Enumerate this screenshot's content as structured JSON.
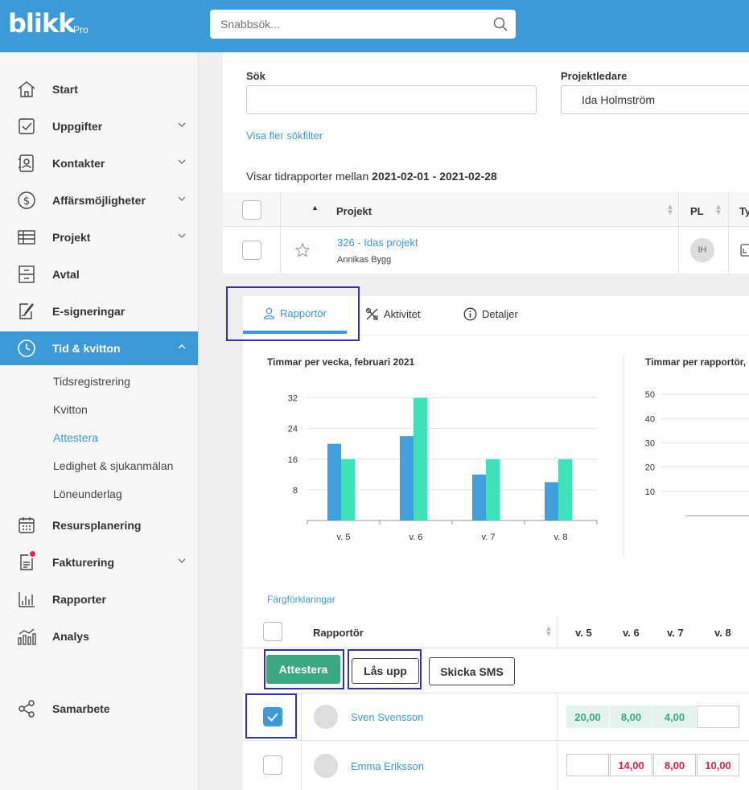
{
  "app": {
    "logo": "blikk",
    "logo_suffix": "Pro"
  },
  "search": {
    "placeholder": "Snabbsök..."
  },
  "sidebar": {
    "items": [
      {
        "label": "Start",
        "icon": "home-icon"
      },
      {
        "label": "Uppgifter",
        "icon": "checkbox-icon"
      },
      {
        "label": "Kontakter",
        "icon": "contacts-icon"
      },
      {
        "label": "Affärsmöjligheter",
        "icon": "dollar-icon"
      },
      {
        "label": "Projekt",
        "icon": "table-icon"
      },
      {
        "label": "Avtal",
        "icon": "cabinet-icon"
      },
      {
        "label": "E-signeringar",
        "icon": "signature-icon"
      },
      {
        "label": "Tid & kvitton",
        "icon": "clock-icon"
      },
      {
        "label": "Resursplanering",
        "icon": "calendar-icon"
      },
      {
        "label": "Fakturering",
        "icon": "invoice-icon"
      },
      {
        "label": "Rapporter",
        "icon": "bar-chart-icon"
      },
      {
        "label": "Analys",
        "icon": "analytics-icon"
      },
      {
        "label": "Samarbete",
        "icon": "share-icon"
      }
    ],
    "sub_items": [
      "Tidsregistrering",
      "Kvitton",
      "Attestera",
      "Ledighet & sjukanmälan",
      "Löneunderlag"
    ]
  },
  "filters": {
    "search_label": "Sök",
    "search_value": "",
    "pl_label": "Projektledare",
    "pl_value": "Ida Holmström",
    "more_filters": "Visa fler sökfilter"
  },
  "range": {
    "prefix": "Visar tidrapporter mellan",
    "dates": "2021-02-01 - 2021-02-28"
  },
  "project_table": {
    "headers": {
      "project": "Projekt",
      "pl": "PL",
      "type": "Ty"
    },
    "row": {
      "name": "326 - Idas projekt",
      "client": "Annikas Bygg",
      "pl_initials": "IH"
    }
  },
  "tabs": [
    {
      "label": "Rapportör",
      "icon": "person-icon"
    },
    {
      "label": "Aktivitet",
      "icon": "tools-icon"
    },
    {
      "label": "Detaljer",
      "icon": "info-icon"
    }
  ],
  "chart_data": [
    {
      "type": "bar",
      "title": "Timmar per vecka, februari 2021",
      "categories": [
        "v. 5",
        "v. 6",
        "v. 7",
        "v. 8"
      ],
      "series": [
        {
          "values": [
            20,
            22,
            12,
            10
          ],
          "color": "#3ea0dc"
        },
        {
          "values": [
            16,
            32,
            16,
            16
          ],
          "color": "#3de2b8"
        }
      ],
      "yticks": [
        8,
        16,
        24,
        32
      ],
      "ylim": [
        0,
        34
      ]
    },
    {
      "type": "bar",
      "title": "Timmar per rapportör,",
      "categories": [],
      "series": [],
      "yticks": [
        10,
        20,
        30,
        40,
        50
      ],
      "ylim": [
        0,
        55
      ]
    }
  ],
  "legend_link": "Färgförklaringar",
  "reporter_table": {
    "header": "Rapportör",
    "weeks": [
      "v. 5",
      "v. 6",
      "v. 7",
      "v. 8"
    ],
    "actions": {
      "approve": "Attestera",
      "unlock": "Lås upp",
      "sms": "Skicka SMS"
    },
    "rows": [
      {
        "name": "Sven Svensson",
        "checked": true,
        "values": [
          "20,00",
          "8,00",
          "4,00",
          ""
        ],
        "styles": [
          "green",
          "green",
          "green",
          "empty"
        ]
      },
      {
        "name": "Emma Eriksson",
        "checked": false,
        "values": [
          "",
          "14,00",
          "8,00",
          "10,00"
        ],
        "styles": [
          "empty",
          "red",
          "red",
          "red"
        ]
      }
    ]
  }
}
